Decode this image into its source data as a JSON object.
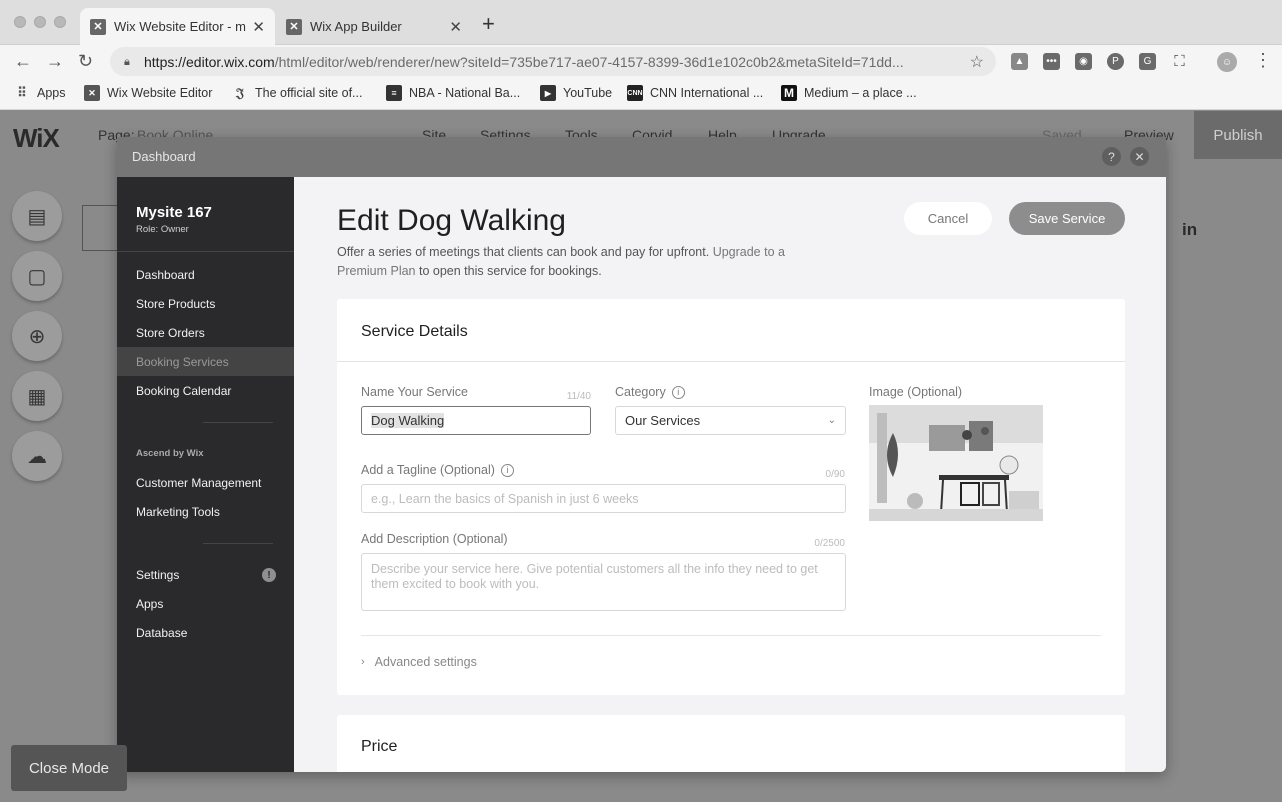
{
  "browser": {
    "tabs": [
      {
        "title": "Wix Website Editor - m",
        "favicon": "wix-favicon"
      },
      {
        "title": "Wix App Builder",
        "favicon": "wix-favicon"
      }
    ],
    "new_tab": "+",
    "url_host": "https://editor.wix.com",
    "url_path": "/html/editor/web/renderer/new?siteId=735be717-ae07-4157-8399-36d1e102c0b2&metaSiteId=71dd...",
    "bookmarks": [
      {
        "label": "Apps",
        "icon": "apps-grid-icon"
      },
      {
        "label": "Wix Website Editor",
        "icon": "wix-favicon"
      },
      {
        "label": "The official site of...",
        "icon": "site-favicon"
      },
      {
        "label": "NBA - National Ba...",
        "icon": "nba-favicon"
      },
      {
        "label": "YouTube",
        "icon": "youtube-favicon"
      },
      {
        "label": "CNN International ...",
        "icon": "cnn-favicon"
      },
      {
        "label": "Medium – a place ...",
        "icon": "medium-favicon"
      }
    ]
  },
  "editor": {
    "logo": "WiX",
    "page_label": "Page:",
    "page_name": "Book Online",
    "menu": [
      "Site",
      "Settings",
      "Tools",
      "Corvid",
      "Help",
      "Upgrade"
    ],
    "saved": "Saved",
    "preview": "Preview",
    "publish": "Publish",
    "close_mode": "Close Mode",
    "social": "in"
  },
  "modal": {
    "title": "Dashboard",
    "help": "?",
    "close": "✕"
  },
  "sidebar": {
    "site_name": "Mysite 167",
    "role": "Role: Owner",
    "items_main": [
      "Dashboard",
      "Store Products",
      "Store Orders",
      "Booking Services",
      "Booking Calendar"
    ],
    "section_label": "Ascend by Wix",
    "items_ascend": [
      "Customer Management",
      "Marketing Tools"
    ],
    "items_bottom": [
      "Settings",
      "Apps",
      "Database"
    ],
    "settings_alert": "!"
  },
  "service": {
    "title": "Edit Dog Walking",
    "description": "Offer a series of meetings that clients can book and pay for upfront.",
    "upgrade_link": "Upgrade to a Premium Plan",
    "description_tail": "to open this service for bookings.",
    "cancel": "Cancel",
    "save": "Save Service",
    "details_title": "Service Details",
    "name_label": "Name Your Service",
    "name_counter": "11/40",
    "name_value": "Dog Walking",
    "category_label": "Category",
    "category_value": "Our Services",
    "image_label": "Image (Optional)",
    "tagline_label": "Add a Tagline (Optional)",
    "tagline_counter": "0/90",
    "tagline_placeholder": "e.g., Learn the basics of Spanish in just 6 weeks",
    "desc_label": "Add Description (Optional)",
    "desc_counter": "0/2500",
    "desc_placeholder": "Describe your service here. Give potential customers all the info they need to get them excited to book with you.",
    "advanced": "Advanced settings",
    "price_title": "Price"
  }
}
